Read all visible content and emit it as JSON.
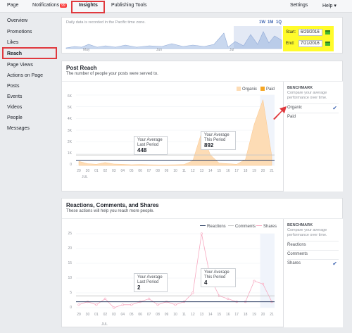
{
  "topbar": {
    "tabs": [
      {
        "label": "Page"
      },
      {
        "label": "Notifications"
      },
      {
        "label": "Insights"
      },
      {
        "label": "Publishing Tools"
      }
    ],
    "notifications_badge": "99",
    "settings": "Settings",
    "help": "Help ▾"
  },
  "sidebar": {
    "items": [
      "Overview",
      "Promotions",
      "Likes",
      "Reach",
      "Page Views",
      "Actions on Page",
      "Posts",
      "Events",
      "Videos",
      "People",
      "Messages"
    ],
    "active": "Reach"
  },
  "range": {
    "note": "Daily data is recorded in the Pacific time zone.",
    "buttons": [
      "1W",
      "1M",
      "1Q"
    ],
    "start_label": "Start:",
    "start_value": "6/29/2016",
    "end_label": "End:",
    "end_value": "7/21/2016",
    "months": [
      "May",
      "Jun",
      "Jul"
    ]
  },
  "post_reach": {
    "title": "Post Reach",
    "subtitle": "The number of people your posts were served to.",
    "legend": [
      "Organic",
      "Paid"
    ],
    "y_ticks": [
      "6K",
      "5K",
      "4K",
      "3K",
      "2K",
      "1K",
      "0"
    ],
    "x_ticks": [
      "29",
      "30",
      "01",
      "02",
      "03",
      "04",
      "05",
      "06",
      "07",
      "08",
      "09",
      "10",
      "11",
      "12",
      "13",
      "14",
      "15",
      "16",
      "17",
      "18",
      "19",
      "20",
      "21"
    ],
    "month": "JUL",
    "avg_last": {
      "label1": "Your Average",
      "label2": "Last Period",
      "value": "448"
    },
    "avg_this": {
      "label1": "Your Average",
      "label2": "This Period",
      "value": "892"
    },
    "benchmark": {
      "head": "BENCHMARK",
      "text": "Compare your average performance over time.",
      "options": [
        "Organic",
        "Paid"
      ]
    }
  },
  "reactions": {
    "title": "Reactions, Comments, and Shares",
    "subtitle": "These actions will help you reach more people.",
    "legend": [
      "Reactions",
      "Comments",
      "Shares"
    ],
    "y_ticks": [
      "25",
      "20",
      "15",
      "10",
      "5",
      "0"
    ],
    "x_ticks": [
      "29",
      "30",
      "01",
      "02",
      "03",
      "04",
      "05",
      "06",
      "07",
      "08",
      "09",
      "10",
      "11",
      "12",
      "13",
      "14",
      "15",
      "16",
      "17",
      "18",
      "19",
      "20",
      "21"
    ],
    "month": "JUL",
    "avg_last": {
      "label1": "Your Average",
      "label2": "Last Period",
      "value": "2"
    },
    "avg_this": {
      "label1": "Your Average",
      "label2": "This Period",
      "value": "4"
    },
    "benchmark": {
      "head": "BENCHMARK",
      "text": "Compare your average performance over time.",
      "options": [
        "Reactions",
        "Comments",
        "Shares"
      ]
    }
  },
  "chart_data": [
    {
      "type": "area",
      "x": [
        "29",
        "30",
        "01",
        "02",
        "03",
        "04",
        "05",
        "06",
        "07",
        "08",
        "09",
        "10",
        "11",
        "12",
        "13",
        "14",
        "15",
        "16",
        "17",
        "18",
        "19",
        "20",
        "21"
      ],
      "series": [
        {
          "name": "Organic",
          "values": [
            350,
            150,
            100,
            250,
            120,
            100,
            60,
            80,
            60,
            50,
            50,
            60,
            80,
            400,
            2800,
            900,
            200,
            150,
            100,
            500,
            3500,
            5600,
            800
          ]
        },
        {
          "name": "Paid",
          "values": [
            0,
            0,
            0,
            0,
            0,
            0,
            0,
            0,
            0,
            0,
            0,
            0,
            0,
            0,
            0,
            0,
            0,
            0,
            0,
            0,
            0,
            0,
            0
          ]
        }
      ],
      "ylim": [
        0,
        6000
      ],
      "colors": {
        "Organic": "#fddcb5",
        "Paid": "#f5a623",
        "avg_last": "#2c3e63",
        "avg_this": "#c8c8c8"
      },
      "averages": {
        "last_period": 448,
        "this_period": 892
      }
    },
    {
      "type": "line",
      "x": [
        "29",
        "30",
        "01",
        "02",
        "03",
        "04",
        "05",
        "06",
        "07",
        "08",
        "09",
        "10",
        "11",
        "12",
        "13",
        "14",
        "15",
        "16",
        "17",
        "18",
        "19",
        "20",
        "21"
      ],
      "series": [
        {
          "name": "Reactions",
          "values": [
            1,
            2,
            1,
            3,
            0,
            1,
            1,
            2,
            3,
            1,
            2,
            1,
            2,
            5,
            25,
            10,
            4,
            3,
            2,
            2,
            9,
            8,
            2
          ]
        },
        {
          "name": "Comments",
          "values": [
            0,
            0,
            0,
            0,
            0,
            0,
            0,
            0,
            0,
            0,
            0,
            0,
            0,
            0,
            0,
            0,
            0,
            0,
            0,
            0,
            0,
            0,
            0
          ]
        },
        {
          "name": "Shares",
          "values": [
            0,
            0,
            0,
            0,
            0,
            0,
            0,
            0,
            0,
            0,
            0,
            0,
            0,
            0,
            0,
            0,
            0,
            0,
            0,
            0,
            0,
            0,
            0
          ]
        }
      ],
      "ylim": [
        0,
        25
      ],
      "colors": {
        "Reactions": "#2c3e63",
        "Comments": "#c8c8c8",
        "Shares": "#f7a8c0"
      },
      "averages": {
        "last_period": 2,
        "this_period": 4
      }
    }
  ]
}
